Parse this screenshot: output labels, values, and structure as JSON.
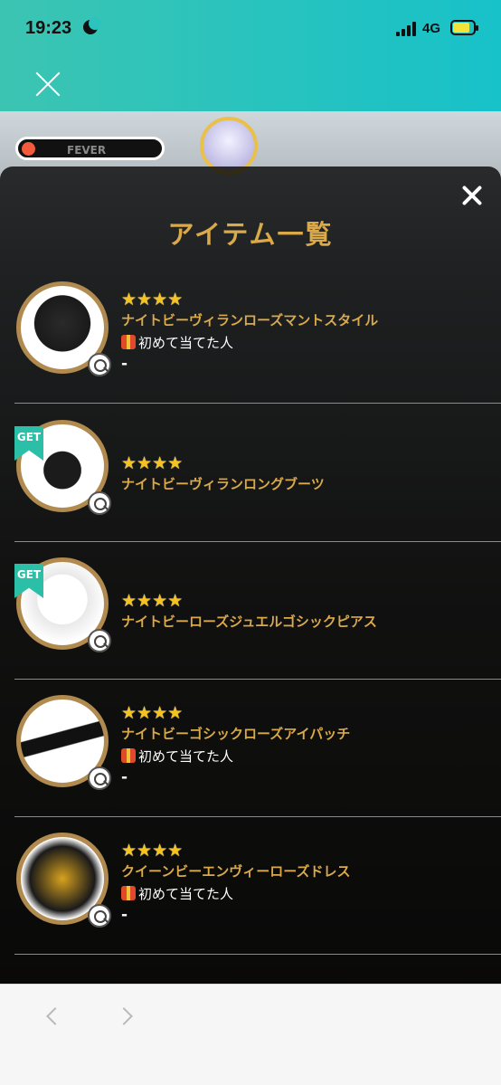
{
  "status": {
    "time": "19:23",
    "network": "4G"
  },
  "game": {
    "fever_label": "FEVER"
  },
  "modal": {
    "title": "アイテム一覧",
    "items": [
      {
        "stars": "★★★★",
        "name": "ナイトビーヴィランローズマントスタイル",
        "note": "初めて当てた人",
        "value": "-",
        "get": false
      },
      {
        "stars": "★★★★",
        "name": "ナイトビーヴィランロングブーツ",
        "note": "",
        "value": "",
        "get": true,
        "get_label": "GET"
      },
      {
        "stars": "★★★★",
        "name": "ナイトビーローズジュエルゴシックピアス",
        "note": "",
        "value": "",
        "get": true,
        "get_label": "GET"
      },
      {
        "stars": "★★★★",
        "name": "ナイトビーゴシックローズアイパッチ",
        "note": "初めて当てた人",
        "value": "-",
        "get": false
      },
      {
        "stars": "★★★★",
        "name": "クイーンビーエンヴィーローズドレス",
        "note": "初めて当てた人",
        "value": "-",
        "get": false
      }
    ]
  }
}
